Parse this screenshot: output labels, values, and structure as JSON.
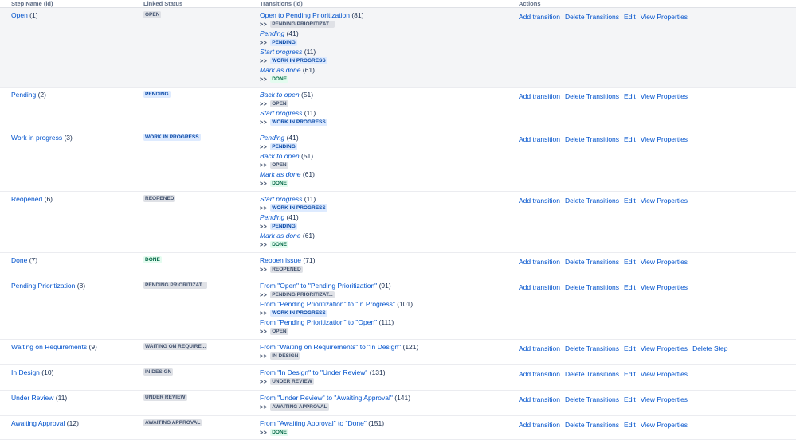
{
  "headers": [
    "Step Name (id)",
    "Linked Status",
    "Transitions (id)",
    "Actions"
  ],
  "actions": [
    "Add transition",
    "Delete Transitions",
    "Edit",
    "View Properties"
  ],
  "delete_step_label": "Delete Step",
  "arrow": ">>",
  "colors": {
    "link": "#0052cc",
    "grey_badge": "#dfe1e6",
    "blue_badge": "#deebff",
    "green_badge": "#e3fcef",
    "highlight": "#f4f5f7"
  },
  "rows": [
    {
      "name": "Open",
      "id": "(1)",
      "status": "OPEN",
      "status_color": "grey",
      "height": 100,
      "highlight": true,
      "transitions": [
        {
          "name": "Open to Pending Prioritization",
          "id": "(81)",
          "italic": false,
          "dest": "PENDING PRIORITIZAT...",
          "dest_color": "grey"
        },
        {
          "name": "Pending",
          "id": "(41)",
          "italic": true,
          "dest": "PENDING",
          "dest_color": "blue"
        },
        {
          "name": "Start progress",
          "id": "(11)",
          "italic": true,
          "dest": "WORK IN PROGRESS",
          "dest_color": "blue"
        },
        {
          "name": "Mark as done",
          "id": "(61)",
          "italic": true,
          "dest": "DONE",
          "dest_color": "green"
        }
      ]
    },
    {
      "name": "Pending",
      "id": "(2)",
      "status": "PENDING",
      "status_color": "blue",
      "height": 54,
      "highlight": false,
      "transitions": [
        {
          "name": "Back to open",
          "id": "(51)",
          "italic": true,
          "dest": "OPEN",
          "dest_color": "grey"
        },
        {
          "name": "Start progress",
          "id": "(11)",
          "italic": true,
          "dest": "WORK IN PROGRESS",
          "dest_color": "blue"
        }
      ]
    },
    {
      "name": "Work in progress",
      "id": "(3)",
      "status": "WORK IN PROGRESS",
      "status_color": "blue",
      "height": 77,
      "highlight": false,
      "transitions": [
        {
          "name": "Pending",
          "id": "(41)",
          "italic": true,
          "dest": "PENDING",
          "dest_color": "blue"
        },
        {
          "name": "Back to open",
          "id": "(51)",
          "italic": true,
          "dest": "OPEN",
          "dest_color": "grey"
        },
        {
          "name": "Mark as done",
          "id": "(61)",
          "italic": true,
          "dest": "DONE",
          "dest_color": "green"
        }
      ]
    },
    {
      "name": "Reopened",
      "id": "(6)",
      "status": "REOPENED",
      "status_color": "grey",
      "height": 77,
      "highlight": false,
      "transitions": [
        {
          "name": "Start progress",
          "id": "(11)",
          "italic": true,
          "dest": "WORK IN PROGRESS",
          "dest_color": "blue"
        },
        {
          "name": "Pending",
          "id": "(41)",
          "italic": true,
          "dest": "PENDING",
          "dest_color": "blue"
        },
        {
          "name": "Mark as done",
          "id": "(61)",
          "italic": true,
          "dest": "DONE",
          "dest_color": "green"
        }
      ]
    },
    {
      "name": "Done",
      "id": "(7)",
      "status": "DONE",
      "status_color": "green",
      "height": 32,
      "highlight": false,
      "transitions": [
        {
          "name": "Reopen issue",
          "id": "(71)",
          "italic": false,
          "dest": "REOPENED",
          "dest_color": "grey"
        }
      ]
    },
    {
      "name": "Pending Prioritization",
      "id": "(8)",
      "status": "PENDING PRIORITIZAT...",
      "status_color": "grey",
      "height": 77,
      "highlight": false,
      "transitions": [
        {
          "name": "From \"Open\" to \"Pending Prioritization\"",
          "id": "(91)",
          "italic": false,
          "dest": "PENDING PRIORITIZAT...",
          "dest_color": "grey"
        },
        {
          "name": "From \"Pending Prioritization\" to \"In Progress\"",
          "id": "(101)",
          "italic": false,
          "dest": "WORK IN PROGRESS",
          "dest_color": "blue"
        },
        {
          "name": "From \"Pending Prioritization\" to \"Open\"",
          "id": "(111)",
          "italic": false,
          "dest": "OPEN",
          "dest_color": "grey"
        }
      ]
    },
    {
      "name": "Waiting on Requirements",
      "id": "(9)",
      "status": "WAITING ON REQUIRE...",
      "status_color": "grey",
      "height": 32,
      "highlight": false,
      "delete_step": true,
      "transitions": [
        {
          "name": "From \"Waiting on Requirements\" to \"In Design\"",
          "id": "(121)",
          "italic": false,
          "dest": "IN DESIGN",
          "dest_color": "grey"
        }
      ]
    },
    {
      "name": "In Design",
      "id": "(10)",
      "status": "IN DESIGN",
      "status_color": "grey",
      "height": 32,
      "highlight": false,
      "transitions": [
        {
          "name": "From \"In Design\" to \"Under Review\"",
          "id": "(131)",
          "italic": false,
          "dest": "UNDER REVIEW",
          "dest_color": "grey"
        }
      ]
    },
    {
      "name": "Under Review",
      "id": "(11)",
      "status": "UNDER REVIEW",
      "status_color": "grey",
      "height": 32,
      "highlight": false,
      "transitions": [
        {
          "name": "From \"Under Review\" to \"Awaiting Approval\"",
          "id": "(141)",
          "italic": false,
          "dest": "AWAITING APPROVAL",
          "dest_color": "grey"
        }
      ]
    },
    {
      "name": "Awaiting Approval",
      "id": "(12)",
      "status": "AWAITING APPROVAL",
      "status_color": "grey",
      "height": 30,
      "highlight": false,
      "transitions": [
        {
          "name": "From \"Awaiting Approval\" to \"Done\"",
          "id": "(151)",
          "italic": false,
          "dest": "DONE",
          "dest_color": "green"
        }
      ]
    }
  ]
}
